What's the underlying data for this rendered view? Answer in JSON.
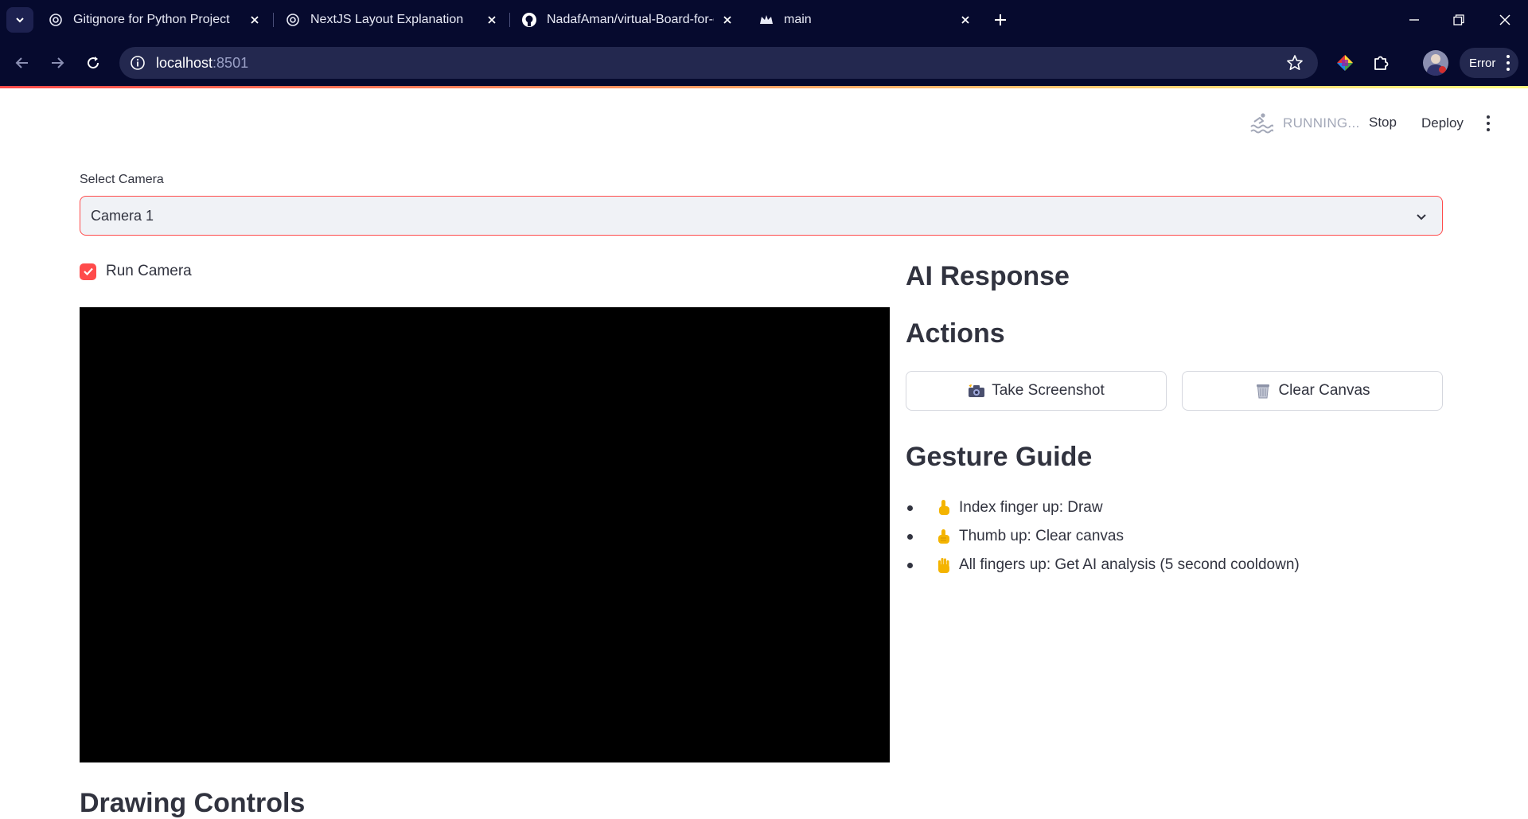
{
  "browser": {
    "tabs": [
      {
        "title": "Gitignore for Python Project",
        "icon": "openai-icon"
      },
      {
        "title": "NextJS Layout Explanation",
        "icon": "openai-icon"
      },
      {
        "title": "NadafAman/virtual-Board-for-c",
        "icon": "github-icon"
      },
      {
        "title": "main",
        "icon": "streamlit-crown-icon"
      }
    ],
    "url_host": "localhost",
    "url_port": ":8501",
    "profile_status": "Error"
  },
  "app_header": {
    "status": "RUNNING...",
    "stop_label": "Stop",
    "deploy_label": "Deploy"
  },
  "camera_select": {
    "label": "Select Camera",
    "value": "Camera 1"
  },
  "run_camera": {
    "label": "Run Camera",
    "checked": true
  },
  "ai_response": {
    "title": "AI Response"
  },
  "actions": {
    "title": "Actions",
    "screenshot_label": "Take Screenshot",
    "clear_label": "Clear Canvas"
  },
  "gesture_guide": {
    "title": "Gesture Guide",
    "items": [
      {
        "icon": "pointing-up-icon",
        "text": "Index finger up: Draw"
      },
      {
        "icon": "thumbs-up-icon",
        "text": "Thumb up: Clear canvas"
      },
      {
        "icon": "raised-hand-icon",
        "text": "All fingers up: Get AI analysis (5 second cooldown)"
      }
    ]
  },
  "drawing_controls": {
    "title": "Drawing Controls"
  },
  "colors": {
    "accent": "#ff4b4b",
    "text": "#31333f",
    "browser_bg": "#060a2e"
  }
}
